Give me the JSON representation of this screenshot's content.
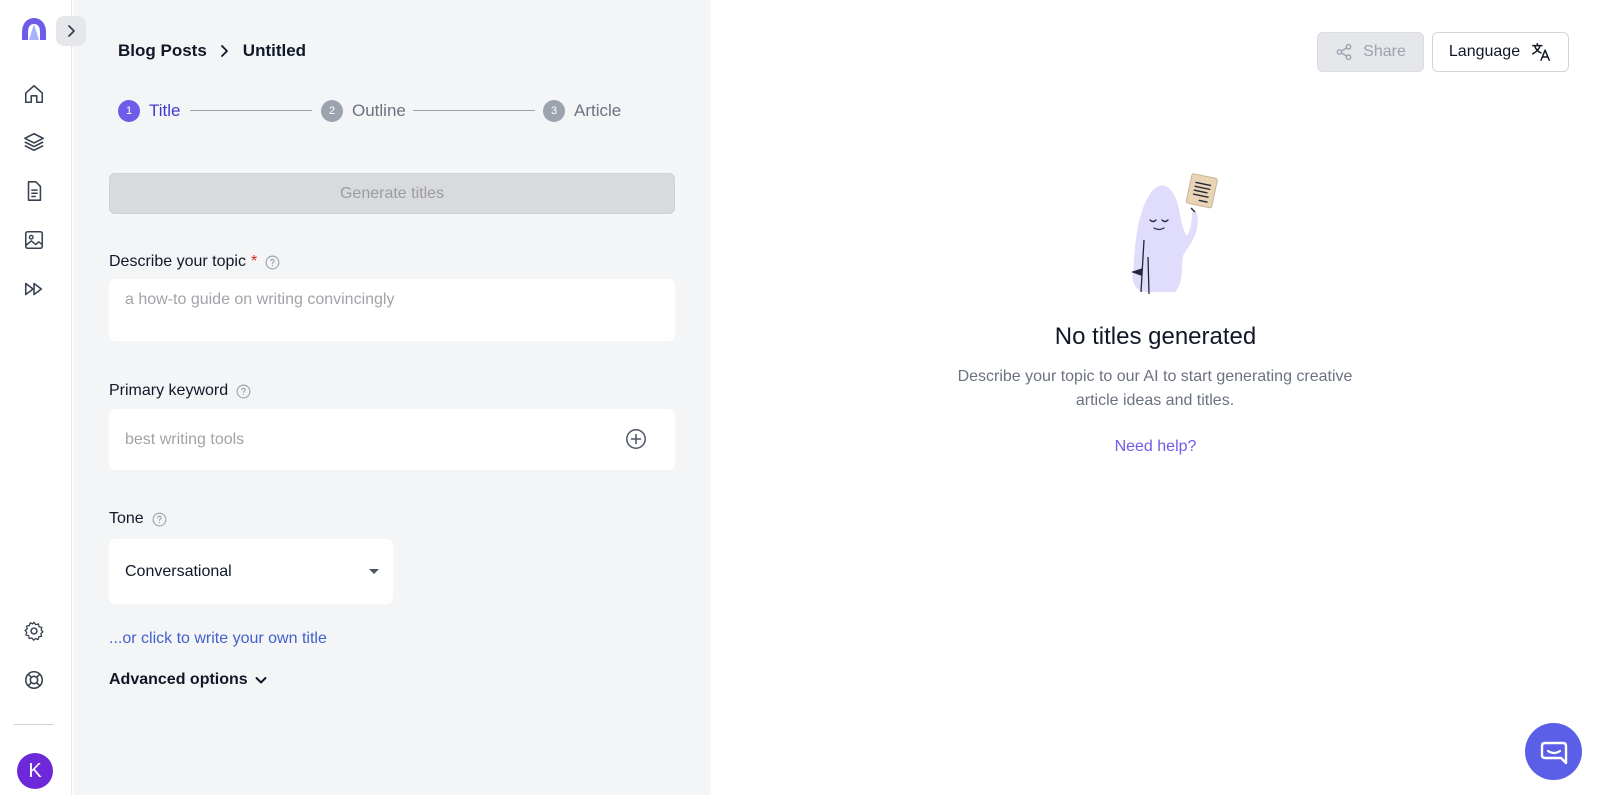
{
  "sidebar": {
    "avatar_initial": "K",
    "nav": [
      {
        "icon": "home-icon"
      },
      {
        "icon": "layers-icon"
      },
      {
        "icon": "document-icon"
      },
      {
        "icon": "image-icon"
      },
      {
        "icon": "fast-forward-icon"
      }
    ],
    "bottom": [
      {
        "icon": "gear-icon"
      },
      {
        "icon": "lifebuoy-icon"
      }
    ]
  },
  "breadcrumb": {
    "section": "Blog Posts",
    "current": "Untitled"
  },
  "stepper": {
    "steps": [
      {
        "number": "1",
        "label": "Title",
        "active": true
      },
      {
        "number": "2",
        "label": "Outline",
        "active": false
      },
      {
        "number": "3",
        "label": "Article",
        "active": false
      }
    ]
  },
  "form": {
    "generate_label": "Generate titles",
    "topic_label": "Describe your topic",
    "topic_required_mark": "*",
    "topic_placeholder": "a how-to guide on writing convincingly",
    "keyword_label": "Primary keyword",
    "keyword_placeholder": "best writing tools",
    "tone_label": "Tone",
    "tone_value": "Conversational",
    "own_title_link": "...or click to write your own title",
    "advanced_label": "Advanced options"
  },
  "toolbar": {
    "share_label": "Share",
    "language_label": "Language"
  },
  "empty_state": {
    "title": "No titles generated",
    "description": "Describe your topic to our AI to start generating creative article ideas and titles.",
    "help_link": "Need help?"
  },
  "colors": {
    "accent": "#6d5ce7",
    "link": "#4361c9",
    "required": "#dc2626",
    "avatar": "#6d28d9",
    "chat_button": "#5b5fe8"
  }
}
